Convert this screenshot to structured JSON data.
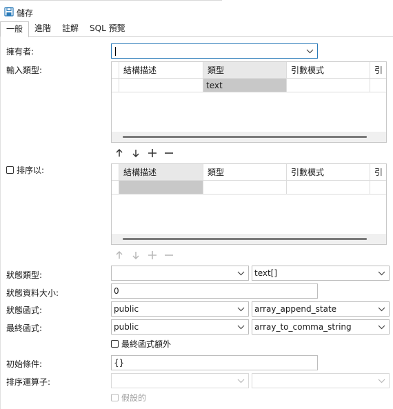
{
  "toolbar": {
    "save_label": "儲存"
  },
  "tabs": [
    {
      "label": "一般",
      "active": true
    },
    {
      "label": "進階"
    },
    {
      "label": "註解"
    },
    {
      "label": "SQL 預覽"
    }
  ],
  "form": {
    "owner": {
      "label": "擁有者:",
      "value": ""
    },
    "input_types": {
      "label": "輸入類型:",
      "columns": [
        "結構描述",
        "類型",
        "引數模式",
        "引"
      ],
      "rows": [
        {
          "schema": "",
          "type": "text",
          "mode": ""
        }
      ]
    },
    "order_by": {
      "label": "排序以:",
      "checked": false,
      "columns": [
        "結構描述",
        "類型",
        "引數模式",
        "引"
      ],
      "rows": [
        {
          "schema": "",
          "type": "",
          "mode": ""
        }
      ]
    },
    "state_type": {
      "label": "狀態類型:",
      "schema": "",
      "value": "text[]"
    },
    "state_size": {
      "label": "狀態資料大小:",
      "value": "0"
    },
    "state_func": {
      "label": "狀態函式:",
      "schema": "public",
      "value": "array_append_state"
    },
    "final_func": {
      "label": "最終函式:",
      "schema": "public",
      "value": "array_to_comma_string"
    },
    "final_extra": {
      "label": "最終函式額外",
      "checked": false
    },
    "init_cond": {
      "label": "初始條件:",
      "value": "{}"
    },
    "sort_op": {
      "label": "排序運算子:",
      "schema": "",
      "value": ""
    },
    "hypothetical": {
      "label": "假設的",
      "checked": false
    }
  },
  "grid_buttons": [
    "上移",
    "下移",
    "新增",
    "刪除"
  ],
  "colors": {
    "accent": "#2b7bb9",
    "selected_cell": "#c8c8c8",
    "border": "#bdbdbd"
  }
}
